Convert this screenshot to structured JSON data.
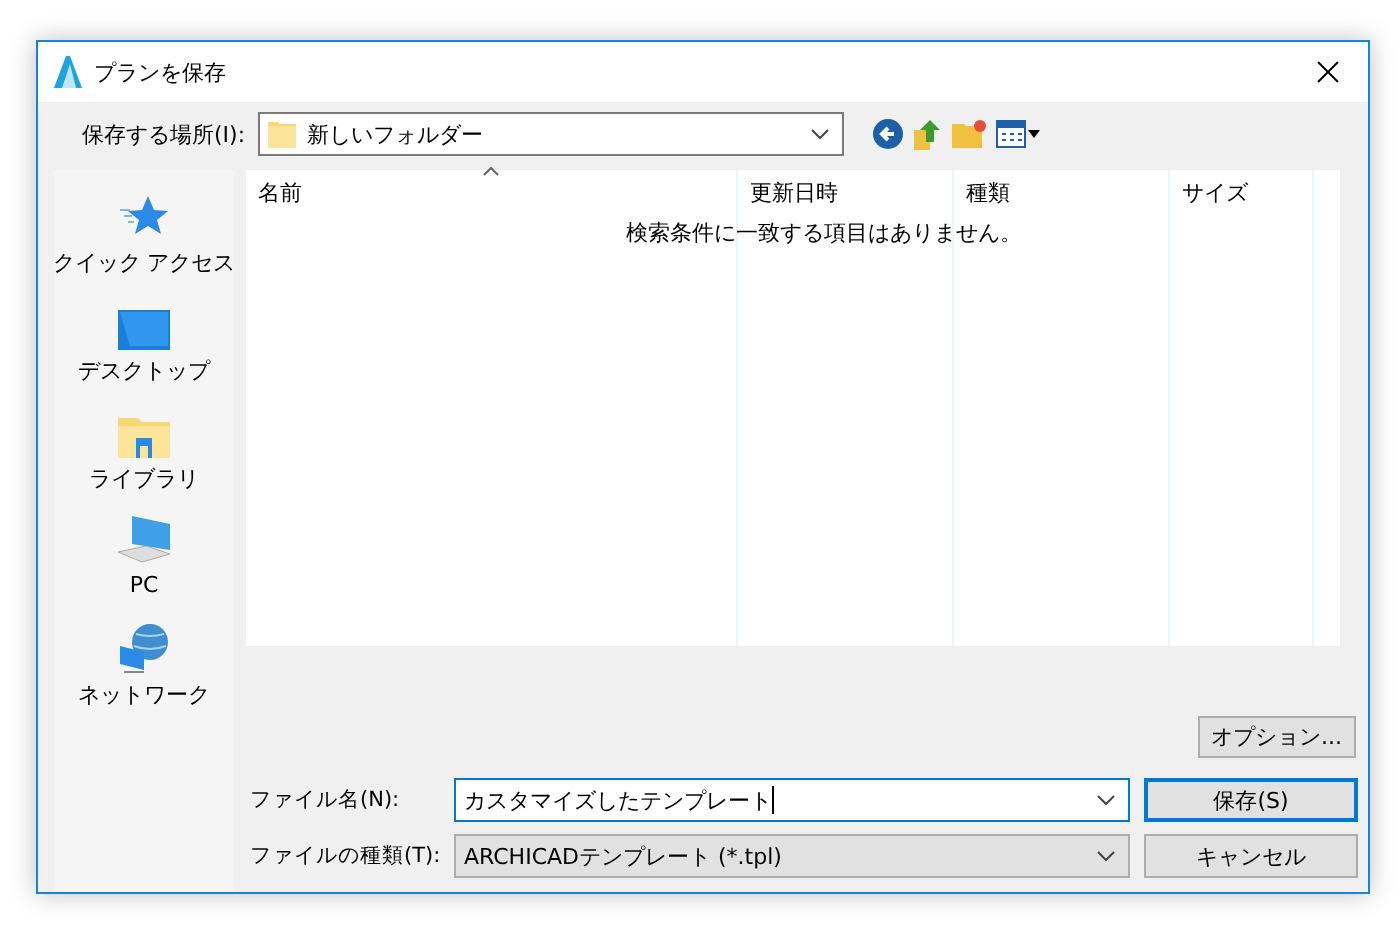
{
  "window": {
    "title": "プランを保存"
  },
  "location": {
    "label": "保存する場所(I):",
    "value": "新しいフォルダー"
  },
  "sidebar": {
    "items": [
      {
        "kind": "quick-access",
        "label": "クイック アクセス"
      },
      {
        "kind": "desktop",
        "label": "デスクトップ"
      },
      {
        "kind": "library",
        "label": "ライブラリ"
      },
      {
        "kind": "pc",
        "label": "PC"
      },
      {
        "kind": "network",
        "label": "ネットワーク"
      }
    ]
  },
  "table": {
    "columns": [
      {
        "label": "名前",
        "sorted": true
      },
      {
        "label": "更新日時",
        "sorted": false
      },
      {
        "label": "種類",
        "sorted": false
      },
      {
        "label": "サイズ",
        "sorted": false
      }
    ],
    "empty_message": "検索条件に一致する項目はありません。"
  },
  "options_button": "オプション...",
  "file_name": {
    "label": "ファイル名(N):",
    "value": "カスタマイズしたテンプレート"
  },
  "file_type": {
    "label": "ファイルの種類(T):",
    "value": "ARCHICADテンプレート (*.tpl)"
  },
  "buttons": [
    {
      "label": "保存(S)",
      "default": true
    },
    {
      "label": "キャンセル",
      "default": false
    }
  ]
}
